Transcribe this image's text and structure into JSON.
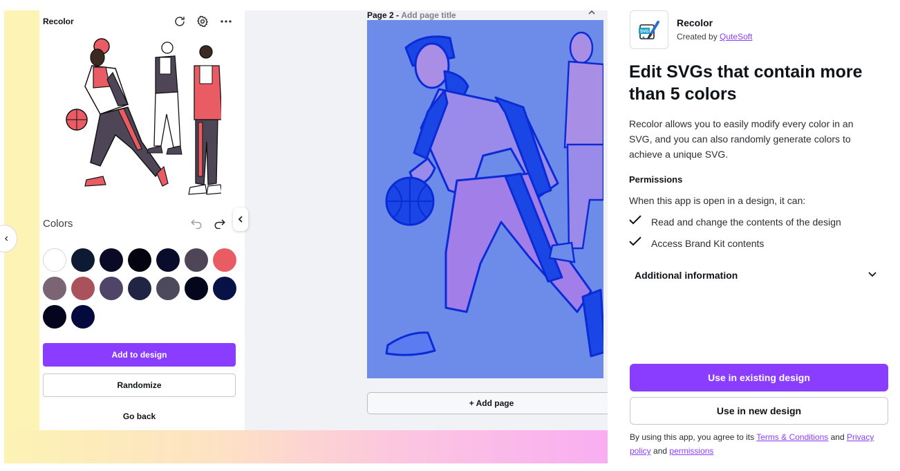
{
  "app_panel": {
    "title": "Recolor",
    "colors_label": "Colors",
    "swatches": [
      "#ffffff",
      "#0c1a33",
      "#0a0a26",
      "#040410",
      "#0a0c2c",
      "#4e4656",
      "#ea5c64",
      "#7b6474",
      "#a9525c",
      "#4f4568",
      "#222444",
      "#4c4a5c",
      "#04061c",
      "#081246",
      "#05051e",
      "#040a3e"
    ],
    "add_button": "Add to design",
    "randomize_button": "Randomize",
    "back_button": "Go back"
  },
  "canvas": {
    "page_number": "Page 2 -",
    "page_title_placeholder": "Add page title",
    "add_page": "+ Add page",
    "background_color": "#6d8ce9"
  },
  "info": {
    "app_name": "Recolor",
    "created_by_prefix": "Created by",
    "author": "QuteSoft",
    "headline": "Edit SVGs that contain more than 5 colors",
    "description": "Recolor allows you to easily modify every color in an SVG, and you can also randomly generate colors to achieve a unique SVG.",
    "permissions_title": "Permissions",
    "permissions_intro": "When this app is open in a design, it can:",
    "permissions": [
      "Read and change the contents of the design",
      "Access Brand Kit contents"
    ],
    "additional_info": "Additional information",
    "use_existing": "Use in existing design",
    "use_new": "Use in new design",
    "terms_prefix": "By using this app, you agree to its",
    "terms_link": "Terms & Conditions",
    "terms_and": "and",
    "privacy_link": "Privacy policy",
    "terms_and2": "and",
    "permissions_link": "permissions",
    "accent": "#8b3dff"
  }
}
